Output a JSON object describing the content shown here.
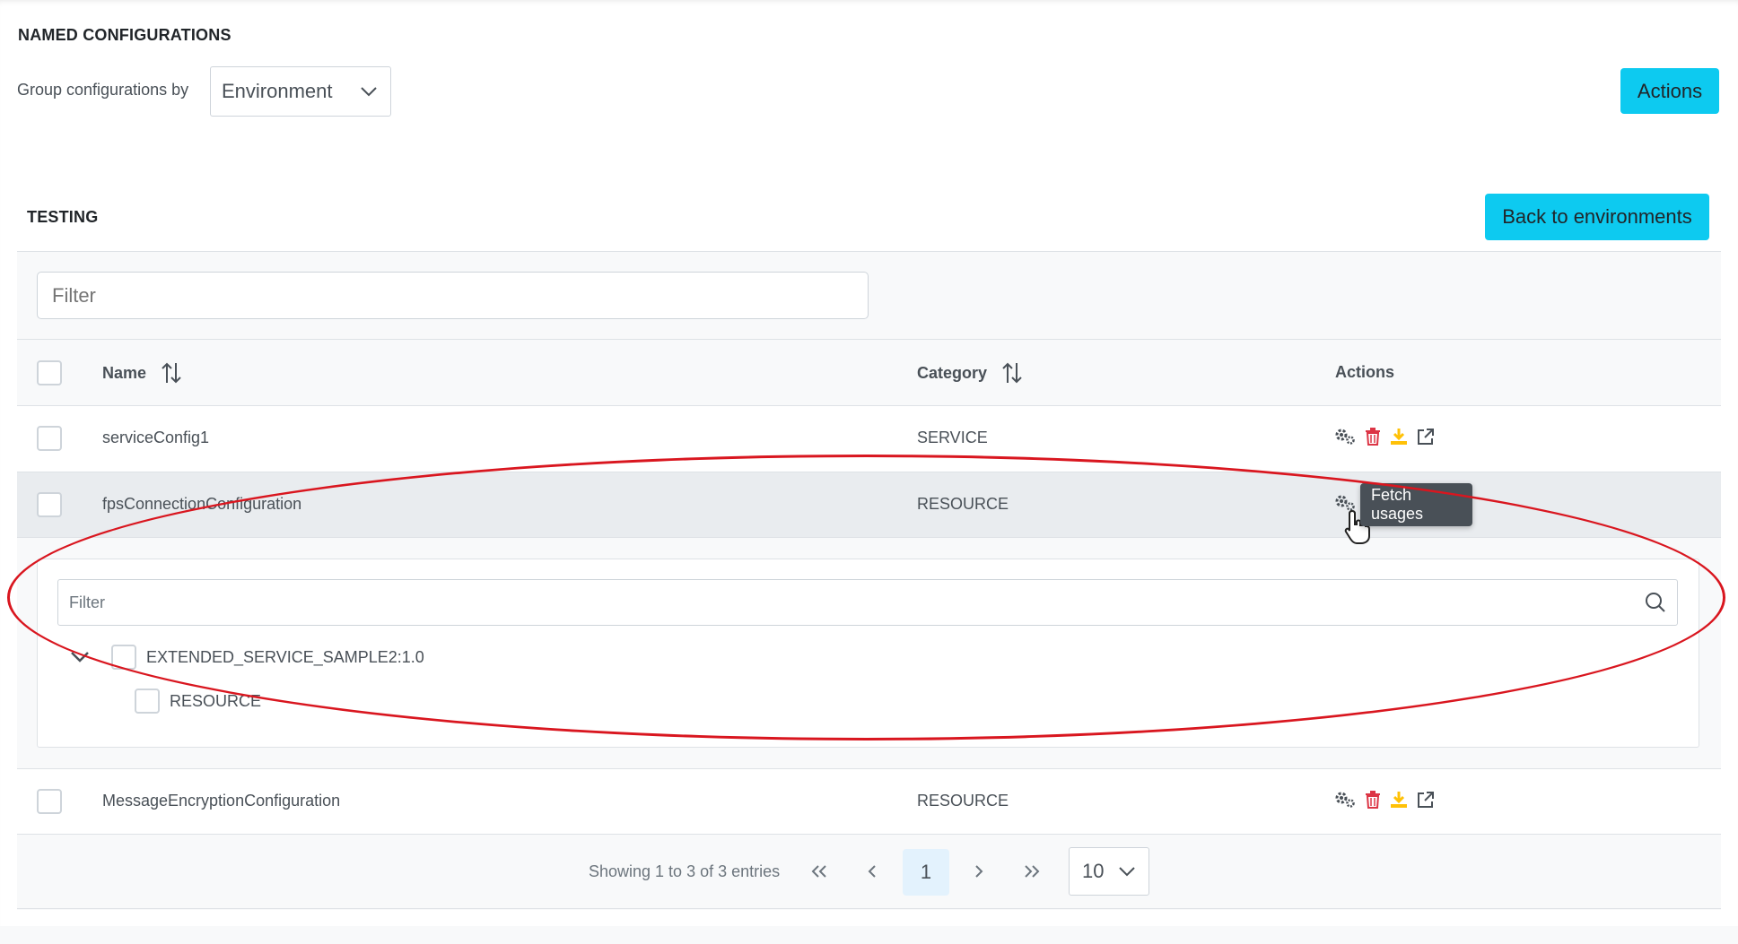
{
  "section": {
    "title": "NAMED CONFIGURATIONS"
  },
  "group_by": {
    "label": "Group configurations by",
    "value": "Environment"
  },
  "header_actions": {
    "label": "Actions"
  },
  "environment": {
    "title": "TESTING",
    "back_label": "Back to environments"
  },
  "table_filter": {
    "placeholder": "Filter"
  },
  "columns": {
    "name": "Name",
    "category": "Category",
    "actions": "Actions"
  },
  "rows": [
    {
      "name": "serviceConfig1",
      "category": "SERVICE"
    },
    {
      "name": "fpsConnectionConfiguration",
      "category": "RESOURCE"
    },
    {
      "name": "MessageEncryptionConfiguration",
      "category": "RESOURCE"
    }
  ],
  "tooltip": {
    "text": "Fetch usages"
  },
  "usages": {
    "filter_placeholder": "Filter",
    "tree": [
      {
        "label": "EXTENDED_SERVICE_SAMPLE2:1.0",
        "children": [
          {
            "label": "RESOURCE"
          }
        ]
      }
    ]
  },
  "pagination": {
    "summary": "Showing 1 to 3 of 3 entries",
    "current_page": "1",
    "per_page": "10"
  },
  "colors": {
    "accent": "#0dcaf0",
    "delete": "#dc3545",
    "export": "#ffc107",
    "annotation": "#d9161f",
    "tooltip_bg": "#495057"
  },
  "icons": {
    "usages": "gears-icon",
    "delete": "trash-icon",
    "export": "download-icon",
    "open": "external-link-icon"
  }
}
